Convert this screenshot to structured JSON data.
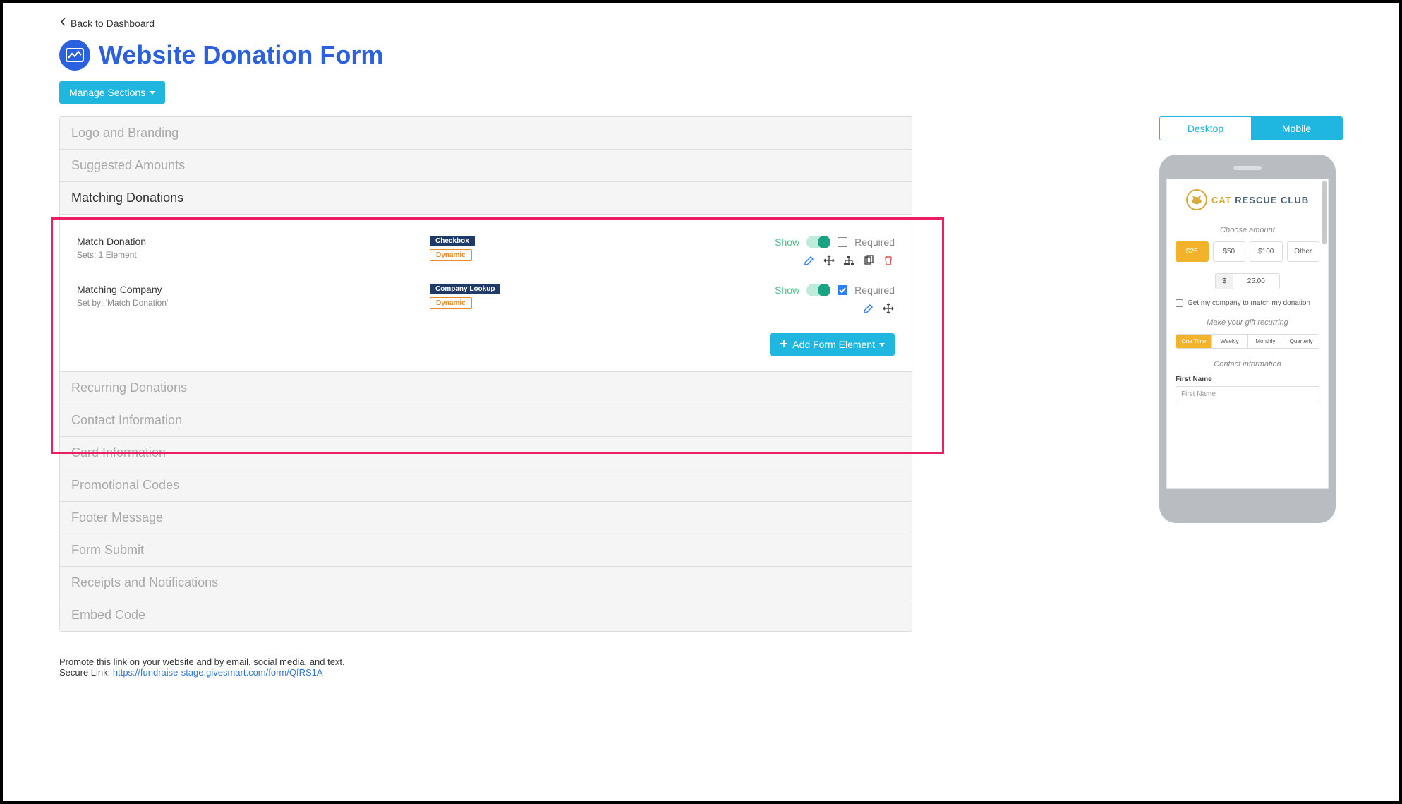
{
  "back_link": "Back to Dashboard",
  "page_title": "Website Donation Form",
  "manage_sections_button": "Manage Sections",
  "sections": [
    {
      "label": "Logo and Branding"
    },
    {
      "label": "Suggested Amounts"
    },
    {
      "label": "Matching Donations",
      "active": true
    },
    {
      "label": "Recurring Donations"
    },
    {
      "label": "Contact Information"
    },
    {
      "label": "Card Information"
    },
    {
      "label": "Promotional Codes"
    },
    {
      "label": "Footer Message"
    },
    {
      "label": "Form Submit"
    },
    {
      "label": "Receipts and Notifications"
    },
    {
      "label": "Embed Code"
    }
  ],
  "matching_section": {
    "elements": [
      {
        "name": "Match Donation",
        "sub": "Sets: 1 Element",
        "type_tag": "Checkbox",
        "dynamic_tag": "Dynamic",
        "show_label": "Show",
        "required_label": "Required",
        "required_checked": false,
        "actions": [
          "edit",
          "move",
          "tree",
          "copy",
          "delete"
        ]
      },
      {
        "name": "Matching Company",
        "sub": "Set by: 'Match Donation'",
        "type_tag": "Company Lookup",
        "dynamic_tag": "Dynamic",
        "show_label": "Show",
        "required_label": "Required",
        "required_checked": true,
        "actions": [
          "edit",
          "move"
        ]
      }
    ],
    "add_button": "Add Form Element"
  },
  "promo_text": "Promote this link on your website and by email, social media, and text.",
  "secure_link_label": "Secure Link: ",
  "secure_link_url": "https://fundraise-stage.givesmart.com/form/QfRS1A",
  "view_tabs": {
    "desktop": "Desktop",
    "mobile": "Mobile"
  },
  "preview": {
    "org_name_a": "CAT ",
    "org_name_b": "RESCUE CLUB",
    "choose_amount": "Choose amount",
    "amounts": [
      "$25",
      "$50",
      "$100",
      "Other"
    ],
    "currency": "$",
    "amount_value": "25.00",
    "match_text": "Get my company to match my donation",
    "recur_label": "Make your gift recurring",
    "recur_options": [
      "One Time",
      "Weekly",
      "Monthly",
      "Quarterly"
    ],
    "contact_label": "Contact information",
    "first_name_label": "First Name",
    "first_name_placeholder": "First Name"
  }
}
